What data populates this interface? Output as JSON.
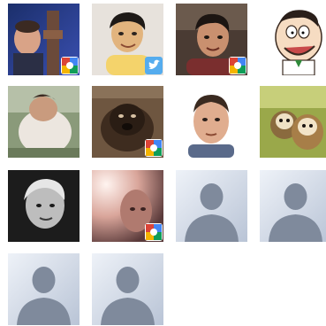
{
  "contacts": [
    {
      "kind": "photo",
      "subject": "man-dark-background",
      "badge": "google-icon"
    },
    {
      "kind": "photo",
      "subject": "smiling-man",
      "badge": "twitter-icon"
    },
    {
      "kind": "photo",
      "subject": "man-dark-hair",
      "badge": "google-icon"
    },
    {
      "kind": "photo",
      "subject": "cartoon-character",
      "badge": null
    },
    {
      "kind": "photo",
      "subject": "person-from-behind",
      "badge": null
    },
    {
      "kind": "photo",
      "subject": "dog",
      "badge": "google-icon"
    },
    {
      "kind": "photo",
      "subject": "man-short-hair",
      "badge": null
    },
    {
      "kind": "photo",
      "subject": "monkeys",
      "badge": null
    },
    {
      "kind": "photo",
      "subject": "grayscale-face",
      "badge": null
    },
    {
      "kind": "photo",
      "subject": "blurry-face",
      "badge": "google-icon"
    },
    {
      "kind": "placeholder",
      "subject": "default-avatar",
      "badge": null
    },
    {
      "kind": "placeholder",
      "subject": "default-avatar",
      "badge": null
    },
    {
      "kind": "placeholder",
      "subject": "default-avatar",
      "badge": null
    },
    {
      "kind": "placeholder",
      "subject": "default-avatar",
      "badge": null
    }
  ],
  "colors": {
    "placeholder_bg_top": "#eef2f8",
    "placeholder_bg_bottom": "#b9c4d6",
    "placeholder_silhouette": "#7f8a9c",
    "google_red": "#db4437",
    "google_blue": "#4285f4",
    "google_green": "#0f9d58",
    "google_yellow": "#f4b400",
    "twitter_blue": "#55acee"
  }
}
